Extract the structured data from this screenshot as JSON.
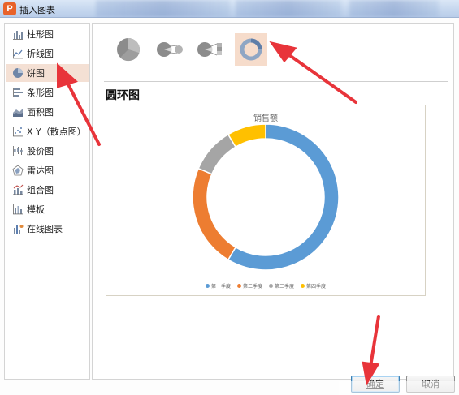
{
  "window": {
    "title": "插入图表"
  },
  "sidebar": {
    "items": [
      {
        "label": "柱形图",
        "icon": "column-chart-icon"
      },
      {
        "label": "折线图",
        "icon": "line-chart-icon"
      },
      {
        "label": "饼图",
        "icon": "pie-chart-icon"
      },
      {
        "label": "条形图",
        "icon": "bar-chart-icon"
      },
      {
        "label": "面积图",
        "icon": "area-chart-icon"
      },
      {
        "label": "X Y（散点图）",
        "icon": "scatter-chart-icon"
      },
      {
        "label": "股价图",
        "icon": "stock-chart-icon"
      },
      {
        "label": "雷达图",
        "icon": "radar-chart-icon"
      },
      {
        "label": "组合图",
        "icon": "combo-chart-icon"
      },
      {
        "label": "模板",
        "icon": "template-icon"
      },
      {
        "label": "在线图表",
        "icon": "online-chart-icon"
      }
    ],
    "selected_index": 2
  },
  "subtypes": {
    "items": [
      {
        "icon": "pie-subtype-icon"
      },
      {
        "icon": "pie-of-pie-subtype-icon"
      },
      {
        "icon": "bar-of-pie-subtype-icon"
      },
      {
        "icon": "doughnut-subtype-icon"
      }
    ],
    "selected_index": 3
  },
  "section": {
    "title": "圆环图"
  },
  "chart_data": {
    "type": "pie",
    "variant": "doughnut",
    "title": "销售额",
    "categories": [
      "第一季度",
      "第二季度",
      "第三季度",
      "第四季度"
    ],
    "values": [
      8.2,
      3.2,
      1.4,
      1.2
    ],
    "colors": [
      "#5b9bd5",
      "#ed7d31",
      "#a5a5a5",
      "#ffc000"
    ],
    "legend_position": "bottom"
  },
  "buttons": {
    "ok_label": "确定",
    "cancel_label": "取消"
  },
  "colors": {
    "selected_bg": "#f6dccb",
    "annotation_arrow": "#e8343a"
  }
}
